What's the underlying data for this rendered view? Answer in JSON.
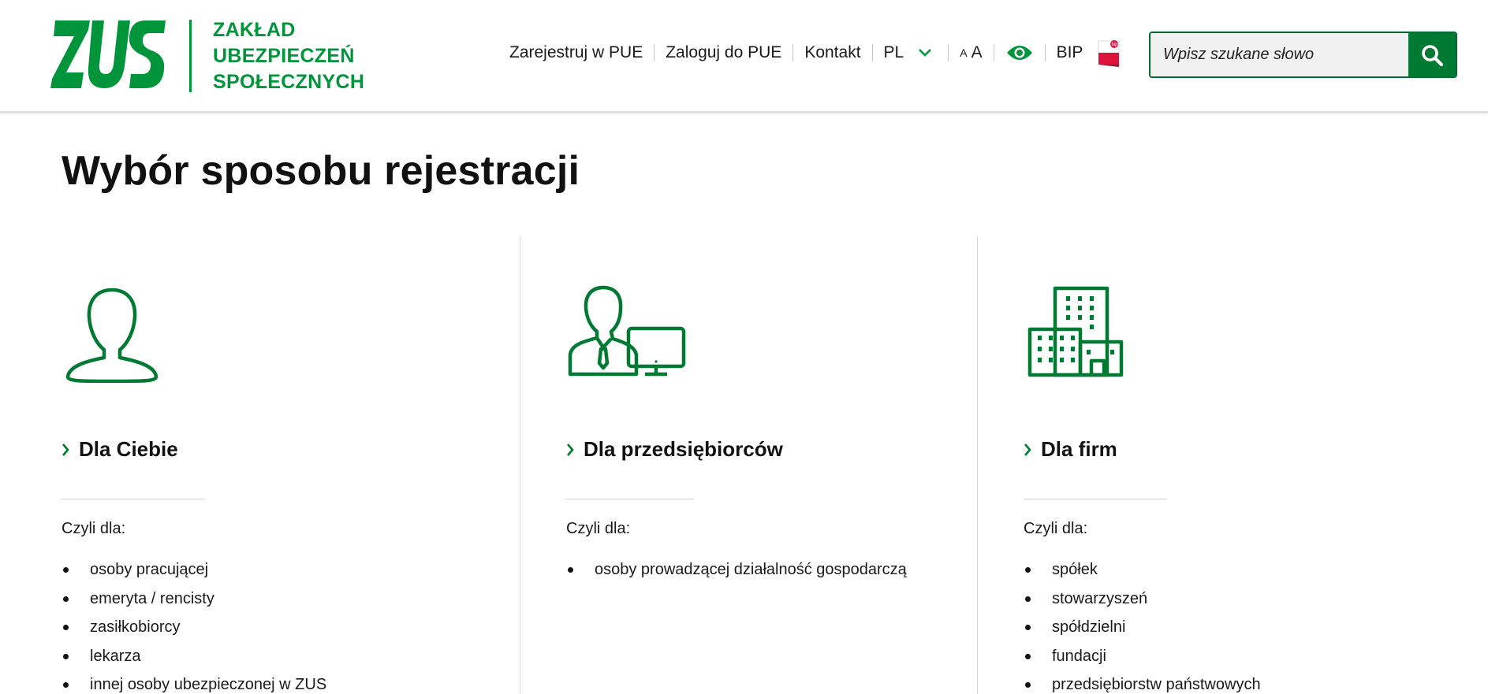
{
  "logo": {
    "mark": "ZUS",
    "line1": "ZAKŁAD",
    "line2": "UBEZPIECZEŃ",
    "line3": "SPOŁECZNYCH",
    "brand_color": "#00953b"
  },
  "nav": {
    "register": "Zarejestruj w PUE",
    "login": "Zaloguj do PUE",
    "contact": "Kontakt",
    "language": "PL",
    "font_small": "A",
    "font_big": "A",
    "contrast_icon": "eye-icon",
    "bip": "BIP",
    "bip_icon": "bip-flag-icon"
  },
  "search": {
    "placeholder": "Wpisz szukane słowo",
    "icon": "search-icon",
    "button_color": "#007a33"
  },
  "page": {
    "title": "Wybór sposobu rejestracji"
  },
  "columns": [
    {
      "icon": "person-icon",
      "title": "Dla Ciebie",
      "subtitle": "Czyli dla:",
      "items": [
        "osoby pracującej",
        "emeryta / rencisty",
        "zasiłkobiorcy",
        "lekarza",
        "innej osoby ubezpieczonej w ZUS"
      ]
    },
    {
      "icon": "entrepreneur-computer-icon",
      "title": "Dla przedsiębiorców",
      "subtitle": "Czyli dla:",
      "items": [
        "osoby prowadzącej działalność gospodarczą"
      ]
    },
    {
      "icon": "office-buildings-icon",
      "title": "Dla firm",
      "subtitle": "Czyli dla:",
      "items": [
        "spółek",
        "stowarzyszeń",
        "spółdzielni",
        "fundacji",
        "przedsiębiorstw państwowych"
      ]
    }
  ]
}
